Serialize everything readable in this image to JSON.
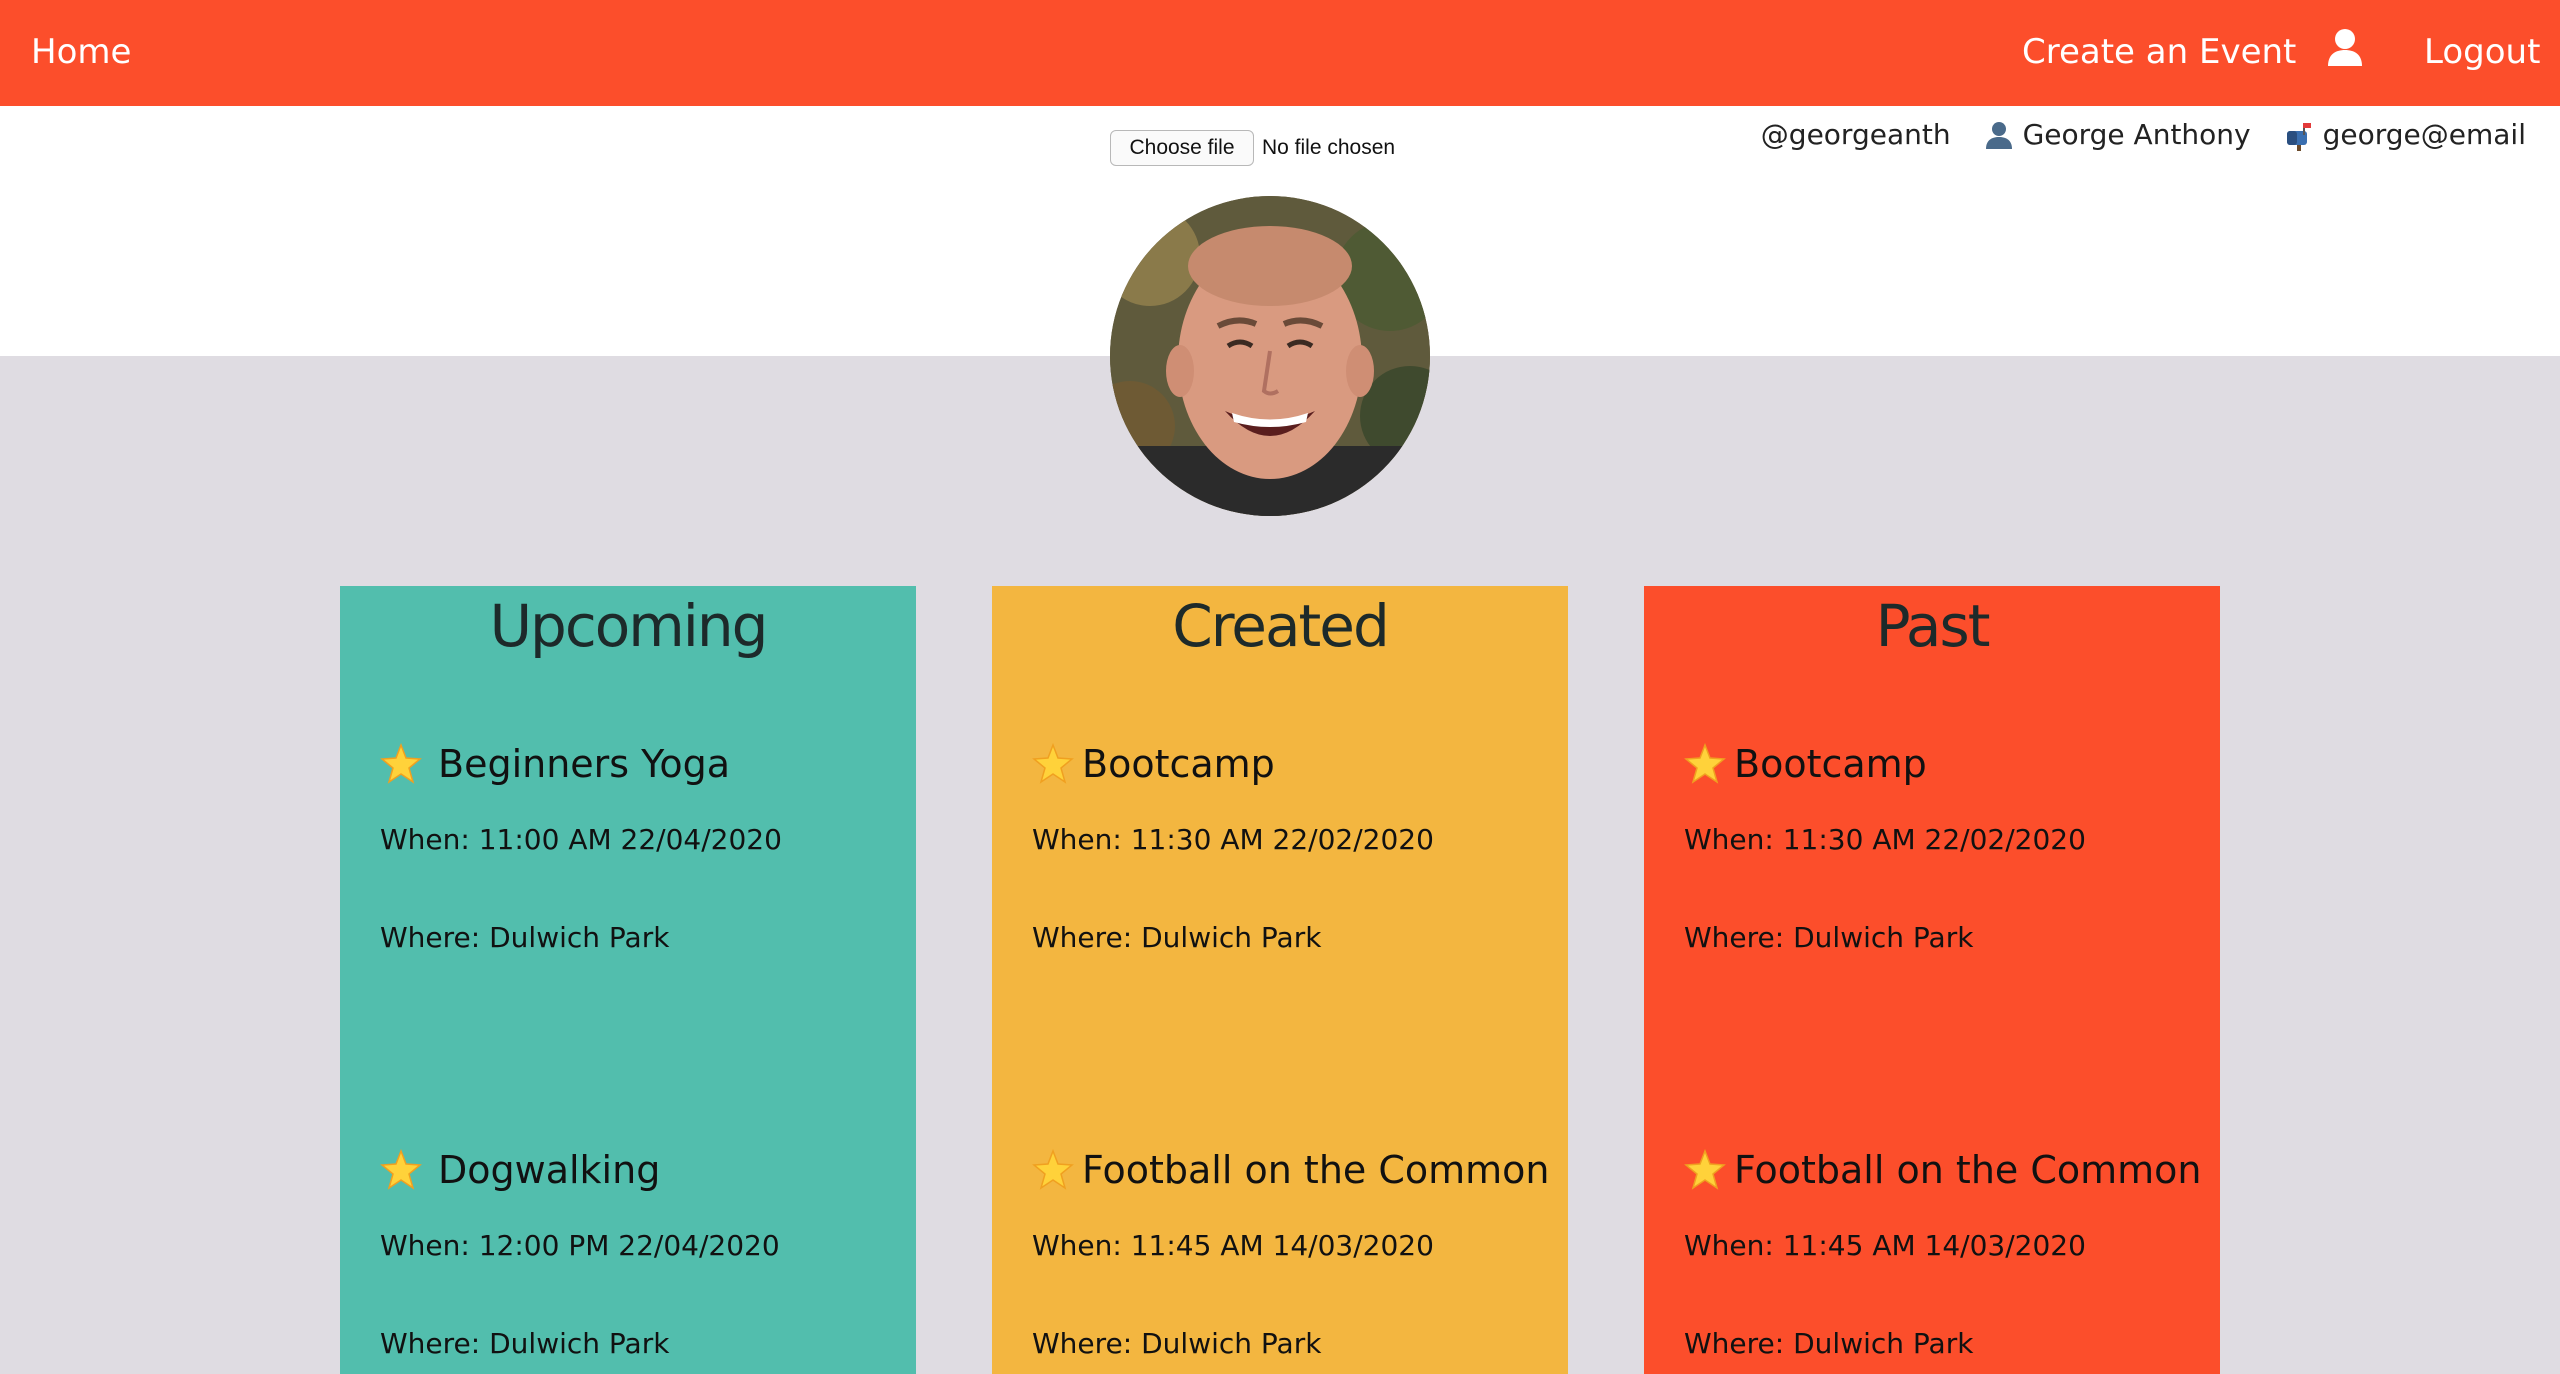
{
  "navbar": {
    "home_label": "Home",
    "create_label": "Create an Event",
    "logout_label": "Logout",
    "background_color": "#fc4e2b"
  },
  "upload": {
    "button_label": "Choose file",
    "status_text": "No file chosen"
  },
  "user": {
    "handle": "@georgeanth",
    "name": "George Anthony",
    "email": "george@email"
  },
  "columns": [
    {
      "title": "Upcoming",
      "color": "#52bead",
      "events": [
        {
          "name": "Beginners Yoga",
          "when": "When: 11:00 AM 22/04/2020",
          "where": "Where: Dulwich Park"
        },
        {
          "name": "Dogwalking",
          "when": "When: 12:00 PM 22/04/2020",
          "where": "Where: Dulwich Park"
        }
      ]
    },
    {
      "title": "Created",
      "color": "#f3b640",
      "events": [
        {
          "name": "Bootcamp",
          "when": "When: 11:30 AM 22/02/2020",
          "where": "Where: Dulwich Park"
        },
        {
          "name": "Football on the Common",
          "when": "When: 11:45 AM 14/03/2020",
          "where": "Where: Dulwich Park"
        }
      ]
    },
    {
      "title": "Past",
      "color": "#fc4e2b",
      "events": [
        {
          "name": "Bootcamp",
          "when": "When: 11:30 AM 22/02/2020",
          "where": "Where: Dulwich Park"
        },
        {
          "name": "Football on the Common",
          "when": "When: 11:45 AM 14/03/2020",
          "where": "Where: Dulwich Park"
        }
      ]
    }
  ]
}
